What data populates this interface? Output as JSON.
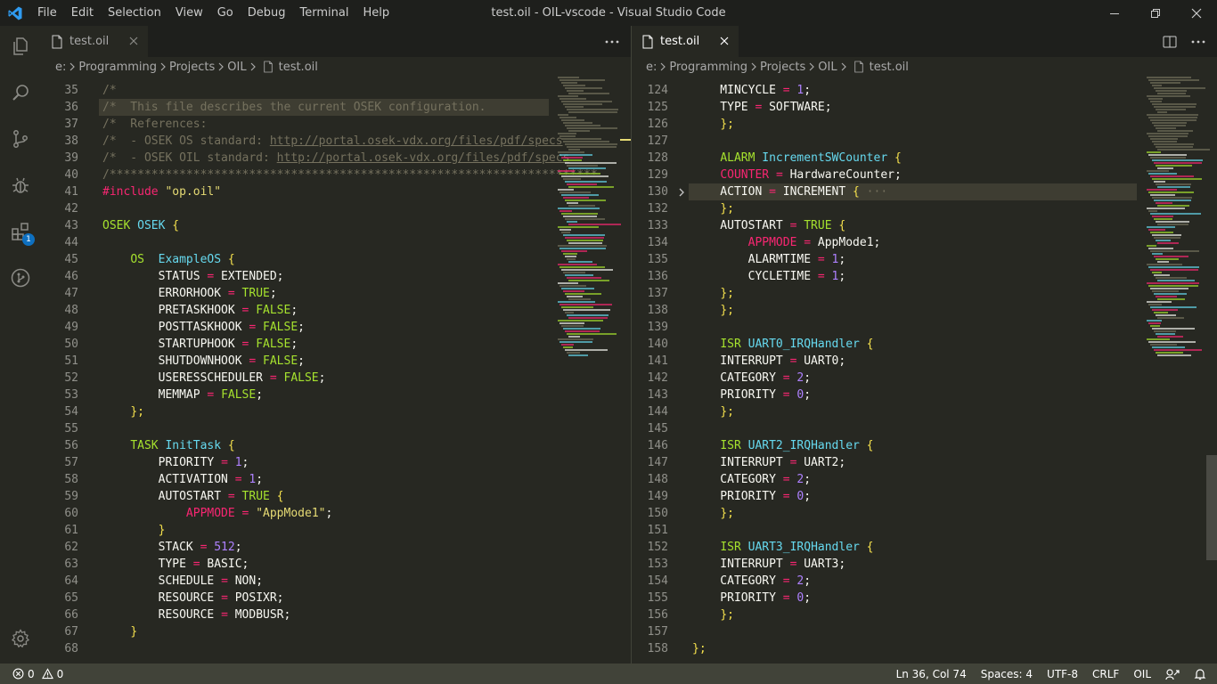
{
  "window": {
    "title": "test.oil - OIL-vscode - Visual Studio Code",
    "menu": [
      "File",
      "Edit",
      "Selection",
      "View",
      "Go",
      "Debug",
      "Terminal",
      "Help"
    ]
  },
  "activity_bar": {
    "items": [
      {
        "name": "explorer-icon"
      },
      {
        "name": "search-icon"
      },
      {
        "name": "source-control-icon"
      },
      {
        "name": "debug-icon"
      },
      {
        "name": "extensions-icon",
        "badge": "1"
      },
      {
        "name": "git-graph-icon"
      }
    ],
    "settings": "gear-icon"
  },
  "left_editor": {
    "tab_label": "test.oil",
    "breadcrumb": [
      "e:",
      "Programming",
      "Projects",
      "OIL",
      "test.oil"
    ],
    "current_line": 36,
    "lines": [
      {
        "n": "35",
        "t": [
          [
            "/*",
            "cm"
          ]
        ]
      },
      {
        "n": "36",
        "t": [
          [
            "/*  This file describes the current OSEK configuration.",
            "cm"
          ]
        ]
      },
      {
        "n": "37",
        "t": [
          [
            "/*  References:",
            "cm"
          ]
        ]
      },
      {
        "n": "38",
        "t": [
          [
            "/*  - OSEK OS standard: ",
            "cm"
          ],
          [
            "http://portal.osek-vdx.org/files/pdf/specs",
            "link"
          ]
        ]
      },
      {
        "n": "39",
        "t": [
          [
            "/*  - OSEK OIL standard: ",
            "cm"
          ],
          [
            "http://portal.osek-vdx.org/files/pdf/specs",
            "link"
          ]
        ]
      },
      {
        "n": "40",
        "t": [
          [
            "/**********************************************************************",
            "cm"
          ]
        ]
      },
      {
        "n": "41",
        "t": [
          [
            "#include ",
            "pp"
          ],
          [
            "\"op.oil\"",
            "str"
          ]
        ]
      },
      {
        "n": "42",
        "t": []
      },
      {
        "n": "43",
        "t": [
          [
            "OSEK ",
            "kw"
          ],
          [
            "OSEK",
            "type"
          ],
          [
            " {",
            "brace"
          ]
        ]
      },
      {
        "n": "44",
        "t": []
      },
      {
        "n": "45",
        "t": [
          [
            "    "
          ],
          [
            "OS",
            "kw"
          ],
          [
            "  "
          ],
          [
            "ExampleOS",
            "type"
          ],
          [
            " {",
            "brace"
          ]
        ]
      },
      {
        "n": "46",
        "t": [
          [
            "        STATUS "
          ],
          [
            "=",
            "op"
          ],
          [
            " EXTENDED;"
          ]
        ]
      },
      {
        "n": "47",
        "t": [
          [
            "        ERRORHOOK "
          ],
          [
            "=",
            "op"
          ],
          [
            " "
          ],
          [
            "TRUE",
            "kw"
          ],
          [
            ";"
          ]
        ]
      },
      {
        "n": "48",
        "t": [
          [
            "        PRETASKHOOK "
          ],
          [
            "=",
            "op"
          ],
          [
            " "
          ],
          [
            "FALSE",
            "kw"
          ],
          [
            ";"
          ]
        ]
      },
      {
        "n": "49",
        "t": [
          [
            "        POSTTASKHOOK "
          ],
          [
            "=",
            "op"
          ],
          [
            " "
          ],
          [
            "FALSE",
            "kw"
          ],
          [
            ";"
          ]
        ]
      },
      {
        "n": "50",
        "t": [
          [
            "        STARTUPHOOK "
          ],
          [
            "=",
            "op"
          ],
          [
            " "
          ],
          [
            "FALSE",
            "kw"
          ],
          [
            ";"
          ]
        ]
      },
      {
        "n": "51",
        "t": [
          [
            "        SHUTDOWNHOOK "
          ],
          [
            "=",
            "op"
          ],
          [
            " "
          ],
          [
            "FALSE",
            "kw"
          ],
          [
            ";"
          ]
        ]
      },
      {
        "n": "52",
        "t": [
          [
            "        USERESSCHEDULER "
          ],
          [
            "=",
            "op"
          ],
          [
            " "
          ],
          [
            "FALSE",
            "kw"
          ],
          [
            ";"
          ]
        ]
      },
      {
        "n": "53",
        "t": [
          [
            "        MEMMAP "
          ],
          [
            "=",
            "op"
          ],
          [
            " "
          ],
          [
            "FALSE",
            "kw"
          ],
          [
            ";"
          ]
        ]
      },
      {
        "n": "54",
        "t": [
          [
            "    "
          ],
          [
            "};",
            "brace"
          ]
        ]
      },
      {
        "n": "55",
        "t": []
      },
      {
        "n": "56",
        "t": [
          [
            "    "
          ],
          [
            "TASK",
            "kw"
          ],
          [
            " "
          ],
          [
            "InitTask",
            "type"
          ],
          [
            " {",
            "brace"
          ]
        ]
      },
      {
        "n": "57",
        "t": [
          [
            "        PRIORITY "
          ],
          [
            "=",
            "op"
          ],
          [
            " "
          ],
          [
            "1",
            "num"
          ],
          [
            ";"
          ]
        ]
      },
      {
        "n": "58",
        "t": [
          [
            "        ACTIVATION "
          ],
          [
            "=",
            "op"
          ],
          [
            " "
          ],
          [
            "1",
            "num"
          ],
          [
            ";"
          ]
        ]
      },
      {
        "n": "59",
        "t": [
          [
            "        AUTOSTART "
          ],
          [
            "=",
            "op"
          ],
          [
            " "
          ],
          [
            "TRUE",
            "kw"
          ],
          [
            " {",
            "brace"
          ]
        ]
      },
      {
        "n": "60",
        "t": [
          [
            "            "
          ],
          [
            "APPMODE",
            "red"
          ],
          [
            " "
          ],
          [
            "=",
            "op"
          ],
          [
            " "
          ],
          [
            "\"AppMode1\"",
            "str"
          ],
          [
            ";"
          ]
        ]
      },
      {
        "n": "61",
        "t": [
          [
            "        "
          ],
          [
            "}",
            "brace"
          ]
        ]
      },
      {
        "n": "62",
        "t": [
          [
            "        STACK "
          ],
          [
            "=",
            "op"
          ],
          [
            " "
          ],
          [
            "512",
            "num"
          ],
          [
            ";"
          ]
        ]
      },
      {
        "n": "63",
        "t": [
          [
            "        TYPE "
          ],
          [
            "=",
            "op"
          ],
          [
            " BASIC;"
          ]
        ]
      },
      {
        "n": "64",
        "t": [
          [
            "        SCHEDULE "
          ],
          [
            "=",
            "op"
          ],
          [
            " NON;"
          ]
        ]
      },
      {
        "n": "65",
        "t": [
          [
            "        RESOURCE "
          ],
          [
            "=",
            "op"
          ],
          [
            " POSIXR;"
          ]
        ]
      },
      {
        "n": "66",
        "t": [
          [
            "        RESOURCE "
          ],
          [
            "=",
            "op"
          ],
          [
            " MODBUSR;"
          ]
        ]
      },
      {
        "n": "67",
        "t": [
          [
            "    "
          ],
          [
            "}",
            "brace"
          ]
        ]
      },
      {
        "n": "68",
        "t": []
      }
    ]
  },
  "right_editor": {
    "tab_label": "test.oil",
    "breadcrumb": [
      "e:",
      "Programming",
      "Projects",
      "OIL",
      "test.oil"
    ],
    "current_line": 130,
    "lines": [
      {
        "n": "124",
        "t": [
          [
            "    MINCYCLE "
          ],
          [
            "=",
            "op"
          ],
          [
            " "
          ],
          [
            "1",
            "num"
          ],
          [
            ";"
          ]
        ]
      },
      {
        "n": "125",
        "t": [
          [
            "    TYPE "
          ],
          [
            "=",
            "op"
          ],
          [
            " SOFTWARE;"
          ]
        ]
      },
      {
        "n": "126",
        "t": [
          [
            "    "
          ],
          [
            "};",
            "brace"
          ]
        ]
      },
      {
        "n": "127",
        "t": []
      },
      {
        "n": "128",
        "t": [
          [
            "    "
          ],
          [
            "ALARM",
            "kw"
          ],
          [
            " "
          ],
          [
            "IncrementSWCounter",
            "type"
          ],
          [
            " {",
            "brace"
          ]
        ]
      },
      {
        "n": "129",
        "t": [
          [
            "    "
          ],
          [
            "COUNTER",
            "red"
          ],
          [
            " "
          ],
          [
            "=",
            "op"
          ],
          [
            " HardwareCounter;"
          ]
        ]
      },
      {
        "n": "130",
        "t": [
          [
            "    ACTION "
          ],
          [
            "=",
            "op"
          ],
          [
            " INCREMENT "
          ],
          [
            "{",
            "brace"
          ],
          [
            " ···",
            "cm"
          ]
        ],
        "fold": true
      },
      {
        "n": "132",
        "t": [
          [
            "    "
          ],
          [
            "};",
            "brace"
          ]
        ]
      },
      {
        "n": "133",
        "t": [
          [
            "    AUTOSTART "
          ],
          [
            "=",
            "op"
          ],
          [
            " "
          ],
          [
            "TRUE",
            "kw"
          ],
          [
            " {",
            "brace"
          ]
        ]
      },
      {
        "n": "134",
        "t": [
          [
            "        "
          ],
          [
            "APPMODE",
            "red"
          ],
          [
            " "
          ],
          [
            "=",
            "op"
          ],
          [
            " AppMode1;"
          ]
        ]
      },
      {
        "n": "135",
        "t": [
          [
            "        ALARMTIME "
          ],
          [
            "=",
            "op"
          ],
          [
            " "
          ],
          [
            "1",
            "num"
          ],
          [
            ";"
          ]
        ]
      },
      {
        "n": "136",
        "t": [
          [
            "        CYCLETIME "
          ],
          [
            "=",
            "op"
          ],
          [
            " "
          ],
          [
            "1",
            "num"
          ],
          [
            ";"
          ]
        ]
      },
      {
        "n": "137",
        "t": [
          [
            "    "
          ],
          [
            "};",
            "brace"
          ]
        ]
      },
      {
        "n": "138",
        "t": [
          [
            "    "
          ],
          [
            "};",
            "brace"
          ]
        ]
      },
      {
        "n": "139",
        "t": []
      },
      {
        "n": "140",
        "t": [
          [
            "    "
          ],
          [
            "ISR",
            "kw"
          ],
          [
            " "
          ],
          [
            "UART0_IRQHandler",
            "type"
          ],
          [
            " {",
            "brace"
          ]
        ]
      },
      {
        "n": "141",
        "t": [
          [
            "    INTERRUPT "
          ],
          [
            "=",
            "op"
          ],
          [
            " UART0;"
          ]
        ]
      },
      {
        "n": "142",
        "t": [
          [
            "    CATEGORY "
          ],
          [
            "=",
            "op"
          ],
          [
            " "
          ],
          [
            "2",
            "num"
          ],
          [
            ";"
          ]
        ]
      },
      {
        "n": "143",
        "t": [
          [
            "    PRIORITY "
          ],
          [
            "=",
            "op"
          ],
          [
            " "
          ],
          [
            "0",
            "num"
          ],
          [
            ";"
          ]
        ]
      },
      {
        "n": "144",
        "t": [
          [
            "    "
          ],
          [
            "};",
            "brace"
          ]
        ]
      },
      {
        "n": "145",
        "t": []
      },
      {
        "n": "146",
        "t": [
          [
            "    "
          ],
          [
            "ISR",
            "kw"
          ],
          [
            " "
          ],
          [
            "UART2_IRQHandler",
            "type"
          ],
          [
            " {",
            "brace"
          ]
        ]
      },
      {
        "n": "147",
        "t": [
          [
            "    INTERRUPT "
          ],
          [
            "=",
            "op"
          ],
          [
            " UART2;"
          ]
        ]
      },
      {
        "n": "148",
        "t": [
          [
            "    CATEGORY "
          ],
          [
            "=",
            "op"
          ],
          [
            " "
          ],
          [
            "2",
            "num"
          ],
          [
            ";"
          ]
        ]
      },
      {
        "n": "149",
        "t": [
          [
            "    PRIORITY "
          ],
          [
            "=",
            "op"
          ],
          [
            " "
          ],
          [
            "0",
            "num"
          ],
          [
            ";"
          ]
        ]
      },
      {
        "n": "150",
        "t": [
          [
            "    "
          ],
          [
            "};",
            "brace"
          ]
        ]
      },
      {
        "n": "151",
        "t": []
      },
      {
        "n": "152",
        "t": [
          [
            "    "
          ],
          [
            "ISR",
            "kw"
          ],
          [
            " "
          ],
          [
            "UART3_IRQHandler",
            "type"
          ],
          [
            " {",
            "brace"
          ]
        ]
      },
      {
        "n": "153",
        "t": [
          [
            "    INTERRUPT "
          ],
          [
            "=",
            "op"
          ],
          [
            " UART3;"
          ]
        ]
      },
      {
        "n": "154",
        "t": [
          [
            "    CATEGORY "
          ],
          [
            "=",
            "op"
          ],
          [
            " "
          ],
          [
            "2",
            "num"
          ],
          [
            ";"
          ]
        ]
      },
      {
        "n": "155",
        "t": [
          [
            "    PRIORITY "
          ],
          [
            "=",
            "op"
          ],
          [
            " "
          ],
          [
            "0",
            "num"
          ],
          [
            ";"
          ]
        ]
      },
      {
        "n": "156",
        "t": [
          [
            "    "
          ],
          [
            "};",
            "brace"
          ]
        ]
      },
      {
        "n": "157",
        "t": []
      },
      {
        "n": "158",
        "t": [
          [
            "};",
            "brace"
          ]
        ]
      }
    ]
  },
  "status_bar": {
    "errors": "0",
    "warnings": "0",
    "position": "Ln 36, Col 74",
    "spaces": "Spaces: 4",
    "encoding": "UTF-8",
    "eol": "CRLF",
    "language": "OIL"
  },
  "colors": {
    "editor_bg": "#272822",
    "chrome_bg": "#1e1f1c",
    "status_bg": "#414339",
    "keyword": "#a6e22e",
    "type": "#66d9ef",
    "number": "#ae81ff",
    "string": "#e6db74",
    "pink": "#f92672",
    "comment": "#75715e"
  }
}
